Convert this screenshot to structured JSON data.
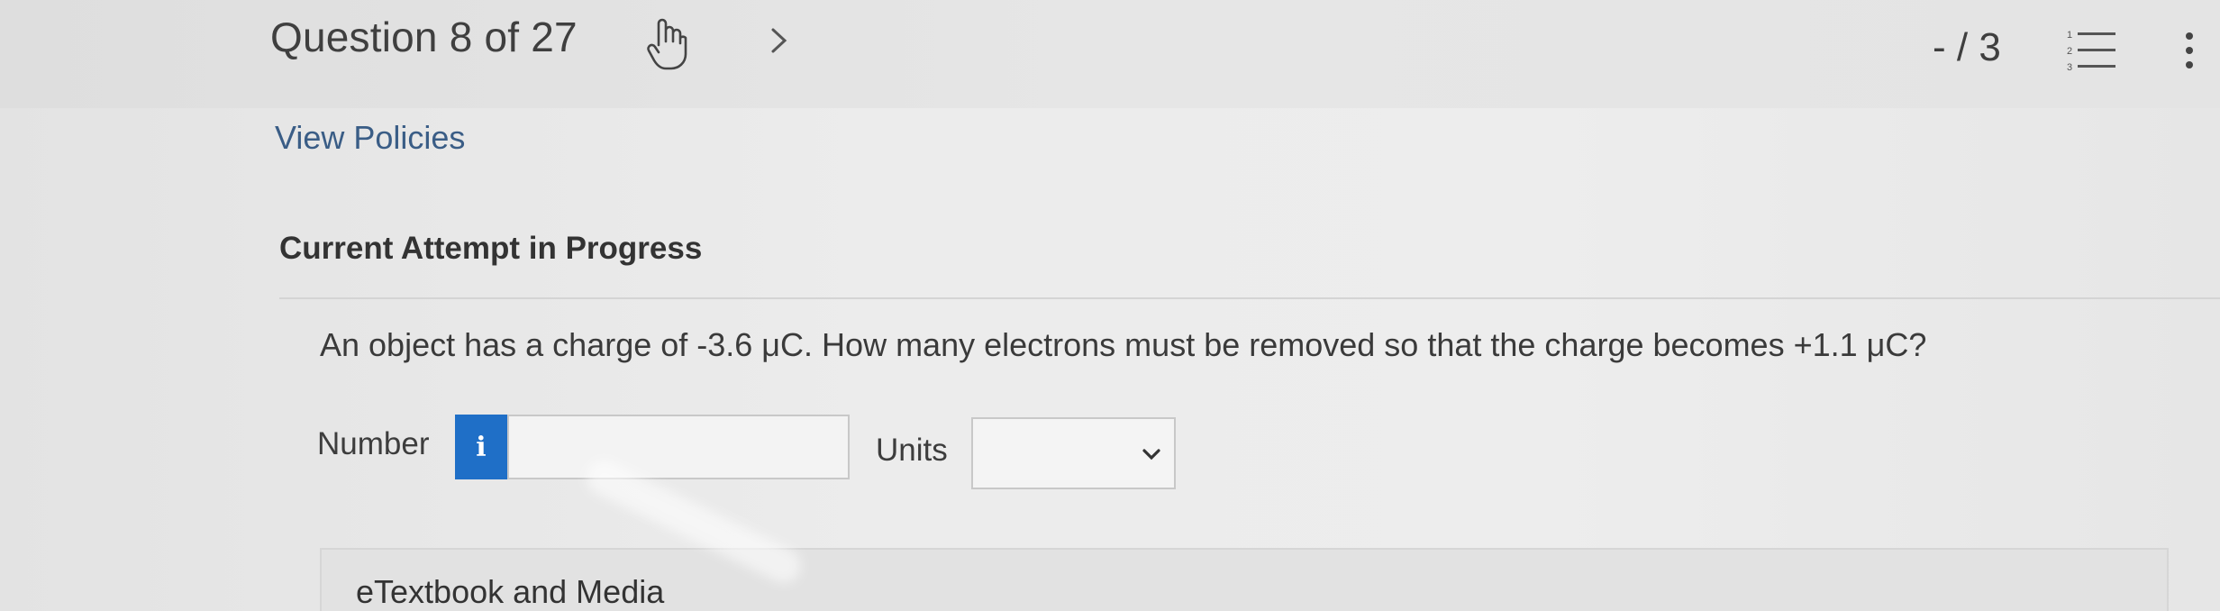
{
  "header": {
    "question_counter": "Question 8 of 27",
    "score": "- / 3",
    "icons": {
      "hand": "hand-pointer-icon",
      "next": "chevron-right-icon",
      "list": "numbered-list-icon",
      "more": "kebab-menu-icon"
    }
  },
  "links": {
    "view_policies": "View Policies"
  },
  "attempt": {
    "heading": "Current Attempt in Progress"
  },
  "question": {
    "text": "An object has a charge of -3.6 μC. How many electrons must be removed so that the charge becomes +1.1 μC?",
    "number_label": "Number",
    "number_value": "",
    "info_icon_glyph": "i",
    "units_label": "Units",
    "units_selected": ""
  },
  "resources": {
    "etextbook_label": "eTextbook and Media"
  },
  "colors": {
    "link": "#3a5d86",
    "info_button": "#1f6fc7"
  }
}
